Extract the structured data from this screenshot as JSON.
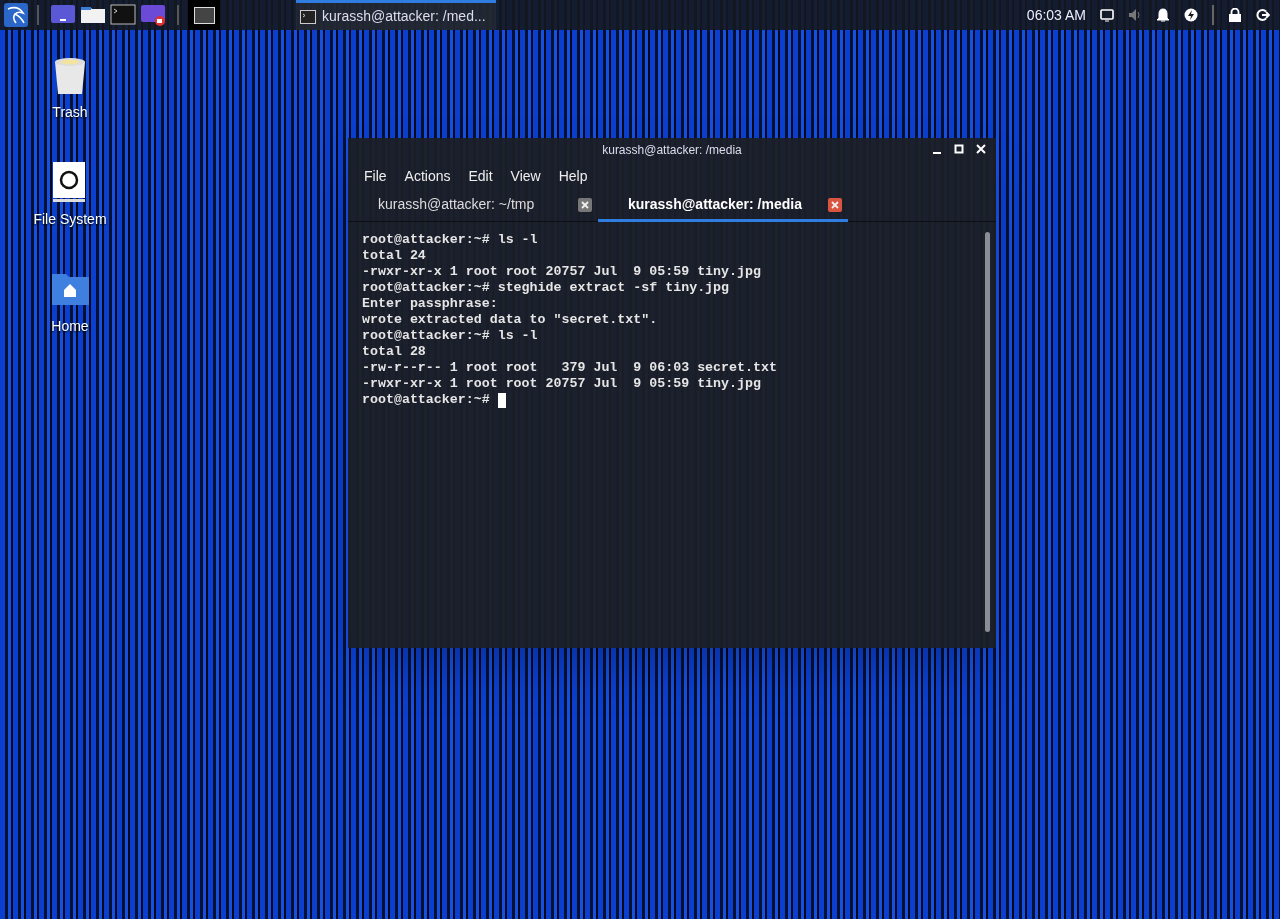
{
  "taskbar": {
    "launchers": [
      {
        "kind": "desktop"
      },
      {
        "kind": "files"
      },
      {
        "kind": "terminal"
      },
      {
        "kind": "recorder"
      }
    ],
    "workspaces": [
      {
        "selected": true
      }
    ],
    "tasks": [
      {
        "label": "kurassh@attacker: /med...",
        "selected": true
      }
    ],
    "clock": "06:03 AM"
  },
  "desktop_icons": [
    {
      "kind": "trash",
      "label": "Trash"
    },
    {
      "kind": "filesystem",
      "label": "File System"
    },
    {
      "kind": "home",
      "label": "Home"
    }
  ],
  "terminal": {
    "title": "kurassh@attacker: /media",
    "menu": [
      "File",
      "Actions",
      "Edit",
      "View",
      "Help"
    ],
    "tabs": [
      {
        "label": "kurassh@attacker: ~/tmp",
        "selected": false
      },
      {
        "label": "kurassh@attacker: /media",
        "selected": true
      }
    ],
    "lines": [
      "root@attacker:~# ls -l",
      "total 24",
      "-rwxr-xr-x 1 root root 20757 Jul  9 05:59 tiny.jpg",
      "root@attacker:~# steghide extract -sf tiny.jpg",
      "Enter passphrase: ",
      "wrote extracted data to \"secret.txt\".",
      "root@attacker:~# ls -l",
      "total 28",
      "-rw-r--r-- 1 root root   379 Jul  9 06:03 secret.txt",
      "-rwxr-xr-x 1 root root 20757 Jul  9 05:59 tiny.jpg",
      "root@attacker:~# "
    ]
  }
}
